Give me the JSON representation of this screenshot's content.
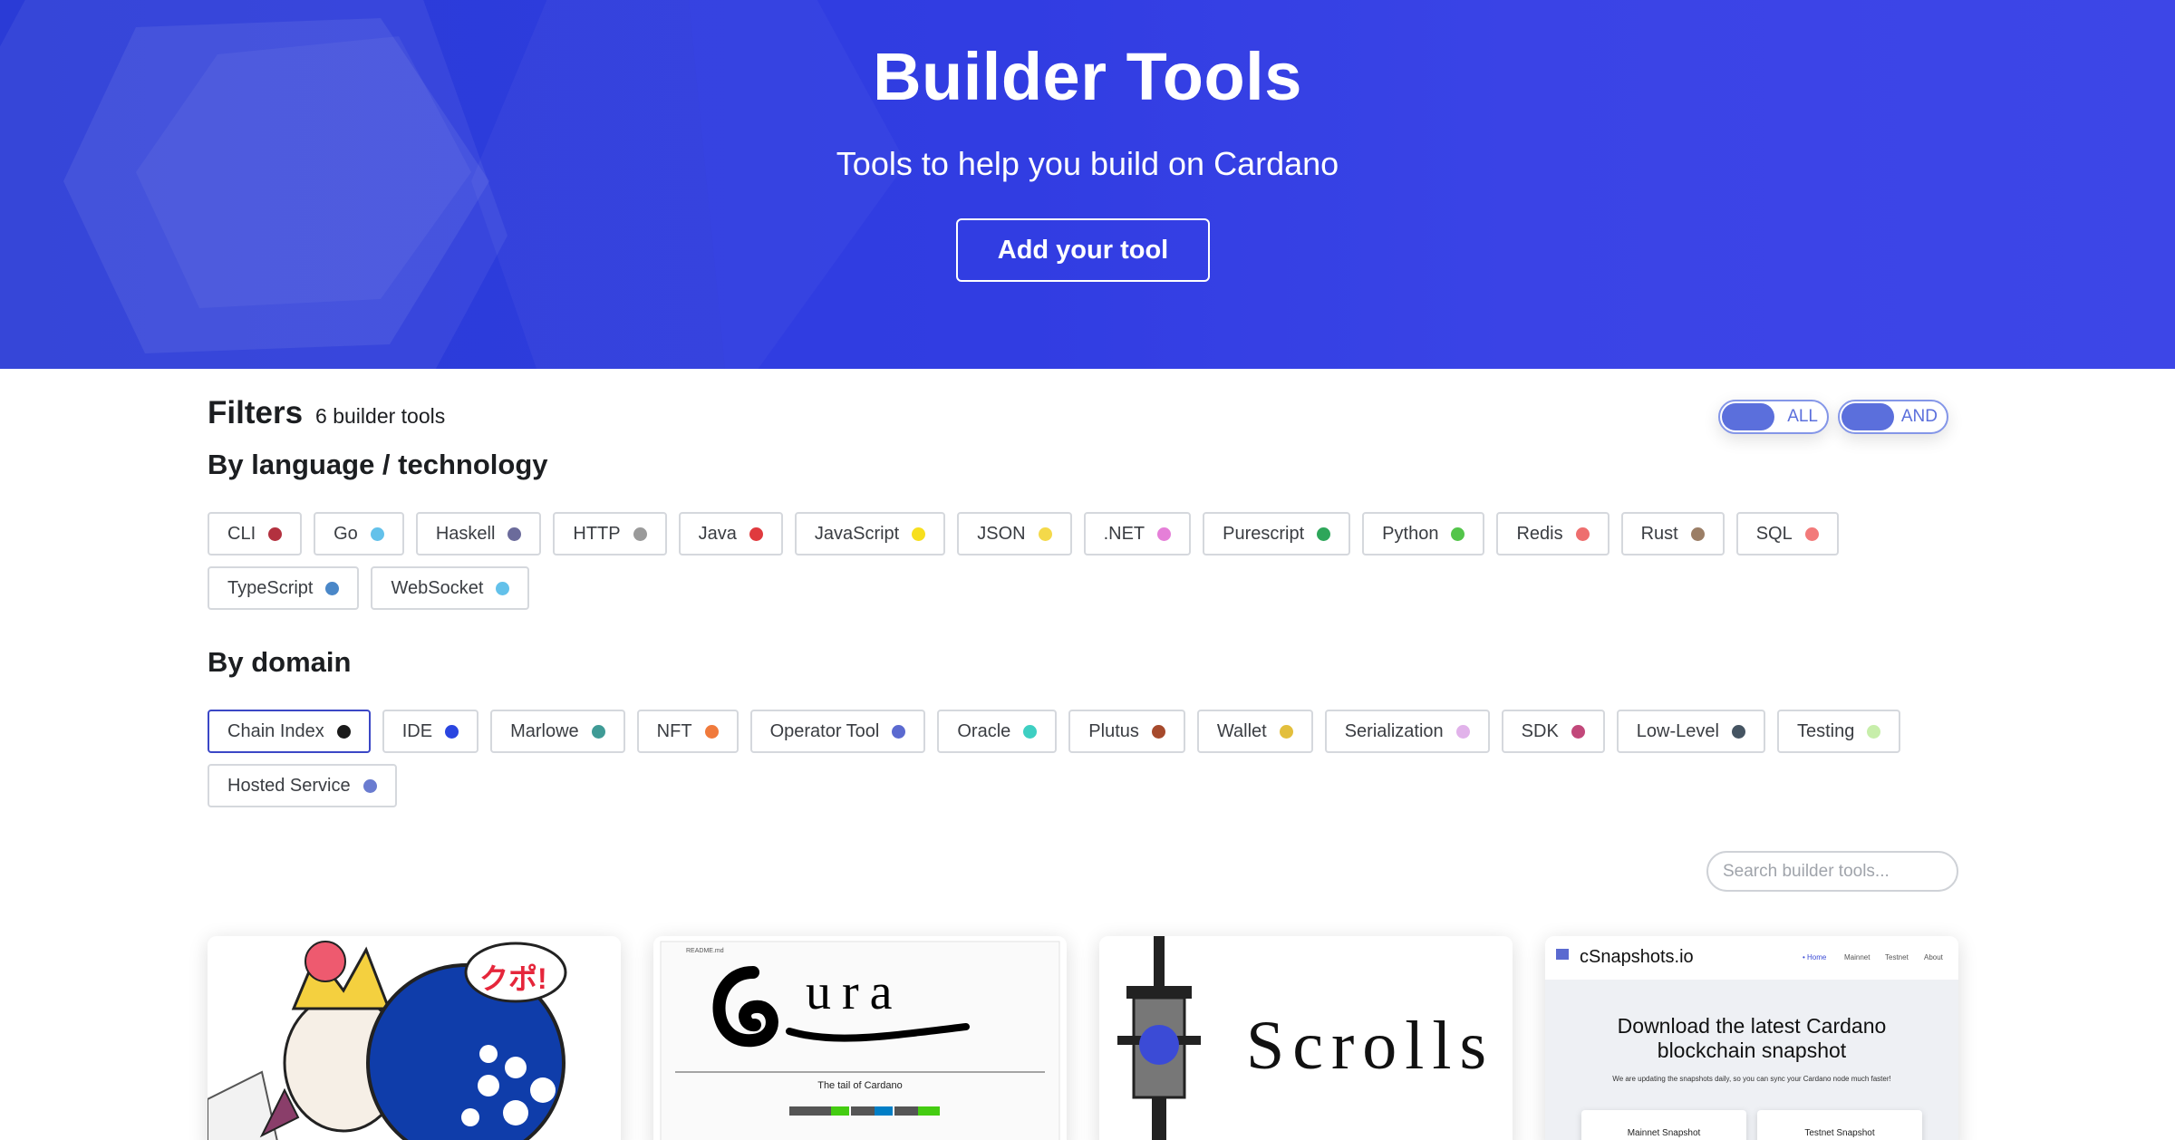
{
  "hero": {
    "title": "Builder Tools",
    "subtitle": "Tools to help you build on Cardano",
    "button_label": "Add your tool"
  },
  "filters": {
    "title": "Filters",
    "count_text": "6 builder tools",
    "toggle_all": "ALL",
    "toggle_and": "AND",
    "language_title": "By language / technology",
    "domain_title": "By domain",
    "languages": [
      {
        "label": "CLI",
        "color": "#b3313f"
      },
      {
        "label": "Go",
        "color": "#63c1ea"
      },
      {
        "label": "Haskell",
        "color": "#6b6b9b"
      },
      {
        "label": "HTTP",
        "color": "#9a9a9a"
      },
      {
        "label": "Java",
        "color": "#e03a3e"
      },
      {
        "label": "JavaScript",
        "color": "#f7df1e"
      },
      {
        "label": "JSON",
        "color": "#f4d94a"
      },
      {
        "label": ".NET",
        "color": "#e57fd8"
      },
      {
        "label": "Purescript",
        "color": "#2ea65a"
      },
      {
        "label": "Python",
        "color": "#53c54a"
      },
      {
        "label": "Redis",
        "color": "#ee6e6e"
      },
      {
        "label": "Rust",
        "color": "#9b7e66"
      },
      {
        "label": "SQL",
        "color": "#f27a7a"
      },
      {
        "label": "TypeScript",
        "color": "#4a87c8"
      },
      {
        "label": "WebSocket",
        "color": "#63c1ea"
      }
    ],
    "domains": [
      {
        "label": "Chain Index",
        "color": "#1a1a1a",
        "selected": true
      },
      {
        "label": "IDE",
        "color": "#2a45e0"
      },
      {
        "label": "Marlowe",
        "color": "#3f9b96"
      },
      {
        "label": "NFT",
        "color": "#f07a3c"
      },
      {
        "label": "Operator Tool",
        "color": "#5b6ad0"
      },
      {
        "label": "Oracle",
        "color": "#3ecfc2"
      },
      {
        "label": "Plutus",
        "color": "#a64a2c"
      },
      {
        "label": "Wallet",
        "color": "#e3bf3c"
      },
      {
        "label": "Serialization",
        "color": "#e1b2ea"
      },
      {
        "label": "SDK",
        "color": "#c2487a"
      },
      {
        "label": "Low-Level",
        "color": "#455462"
      },
      {
        "label": "Testing",
        "color": "#c7eeaa"
      },
      {
        "label": "Hosted Service",
        "color": "#6a7cd0"
      }
    ]
  },
  "search": {
    "placeholder": "Search builder tools..."
  },
  "cards": {
    "kupo": {
      "badge": "クポ!"
    },
    "oura": {
      "readme": "README.md",
      "logo_text": "ura",
      "tagline": "The tail of Cardano"
    },
    "scrolls": {
      "logo_text": "Scrolls"
    },
    "csnapshots": {
      "brand": "cSnapshots.io",
      "nav": [
        "• Home",
        "Mainnet",
        "Testnet",
        "About"
      ],
      "headline_1": "Download the latest Cardano",
      "headline_2": "blockchain snapshot",
      "note": "We are updating the snapshots daily, so you can sync your Cardano node much faster!",
      "box_1": "Mainnet Snapshot",
      "box_2": "Testnet Snapshot"
    }
  }
}
